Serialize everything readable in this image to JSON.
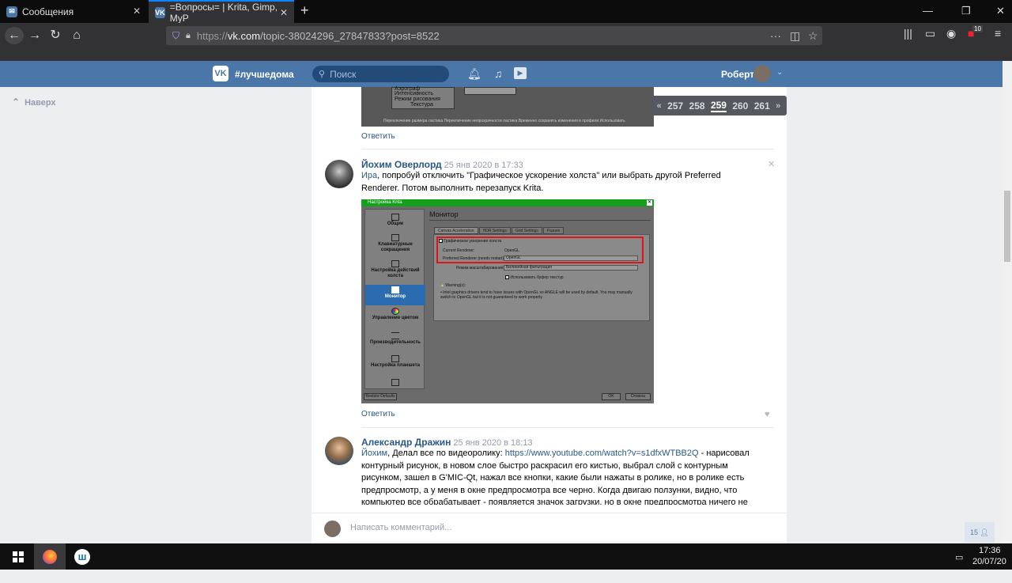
{
  "browser": {
    "tabs": [
      {
        "title": "Сообщения",
        "active": false
      },
      {
        "title": "=Вопросы= | Krita, Gimp, MyP",
        "active": true
      }
    ],
    "url": {
      "scheme": "https://",
      "host": "vk.com",
      "path": "/topic-38024296_27847833?post=8522"
    },
    "badge_count": "10"
  },
  "vk_header": {
    "logo": "VK",
    "community": "#лучшедома",
    "search_placeholder": "Поиск",
    "user_name": "Роберт"
  },
  "left_nav": {
    "up_label": "Наверх"
  },
  "pager": {
    "prev": "«",
    "pages": [
      "257",
      "258",
      "259",
      "260",
      "261"
    ],
    "current": "259",
    "next": "»"
  },
  "top_screenshot": {
    "rows": [
      "Аэрограф",
      "Интенсивность",
      "Режим рисования",
      "Текстура"
    ],
    "footer": "Переключение размера ластика   Переключение непрозрачности ластика   Временно сохранять изменения в профили   Использовать"
  },
  "posts": [
    {
      "author": "Йохим Оверлорд",
      "date": "25 янв 2020 в 17:33",
      "mention": "Ира",
      "text": ", попробуй отключить \"Графическое ускорение холста\" или выбрать другой Preferred Renderer. Потом выполнить перезапуск Krita.",
      "reply_label": "Ответить",
      "krita": {
        "title": "Настройка Krita",
        "heading": "Монитор",
        "sidebar": [
          "Общие",
          "Клавиатурные сокращения",
          "Настройка действий холста",
          "Монитор",
          "Управление цветом",
          "Производительность",
          "Настройка планшета"
        ],
        "tabs": [
          "Canvas Acceleration",
          "HDR Settings",
          "Grid Settings",
          "Разное"
        ],
        "checkbox_label": "Графическое ускорение холста",
        "current_renderer_label": "Current Renderer:",
        "current_renderer_value": "OpenGL",
        "preferred_renderer_label": "Preferred Renderer (needs restart):",
        "preferred_renderer_value": "OpenGL",
        "scaling_label": "Режим масштабирования:",
        "scaling_value": "Билинейная фильтрация",
        "texture_buffer_label": "Использовать буфер текстур",
        "warning_title": "Warning(s):",
        "warning_text": "• Intel graphics drivers tend to have issues with OpenGL so ANGLE will be used by default. You may manually switch to OpenGL but it is not guaranteed to work properly.",
        "restore_defaults": "Restore Defaults",
        "ok": "OK",
        "cancel": "Отмена"
      }
    },
    {
      "author": "Александр Дражин",
      "date": "25 янв 2020 в 18:13",
      "mention": "Йохим",
      "text_before_link": ", Делал все по видеоролику: ",
      "link": "https://www.youtube.com/watch?v=s1dfxWTBB2Q",
      "text_after_link": " - нарисовал контурный рисунок, в новом слое быстро раскрасил его кистью, выбрал слой с контурным рисунком, зашел в G'MIC-Qt, нажал все кнопки, какие были нажаты в ролике, но в ролике есть предпросмотр, а у меня в окне предпросмотра все черно. Когда двигаю ползунки, видно, что компьютер все обрабатывает - появляется значок загрузки, но в окне предпросмотра ничего не отображается."
    }
  ],
  "reply_label_top": "Ответить",
  "comment_box": {
    "placeholder": "Написать комментарий..."
  },
  "online_count": "15",
  "taskbar": {
    "time": "17:36",
    "date": "20/07/20"
  }
}
